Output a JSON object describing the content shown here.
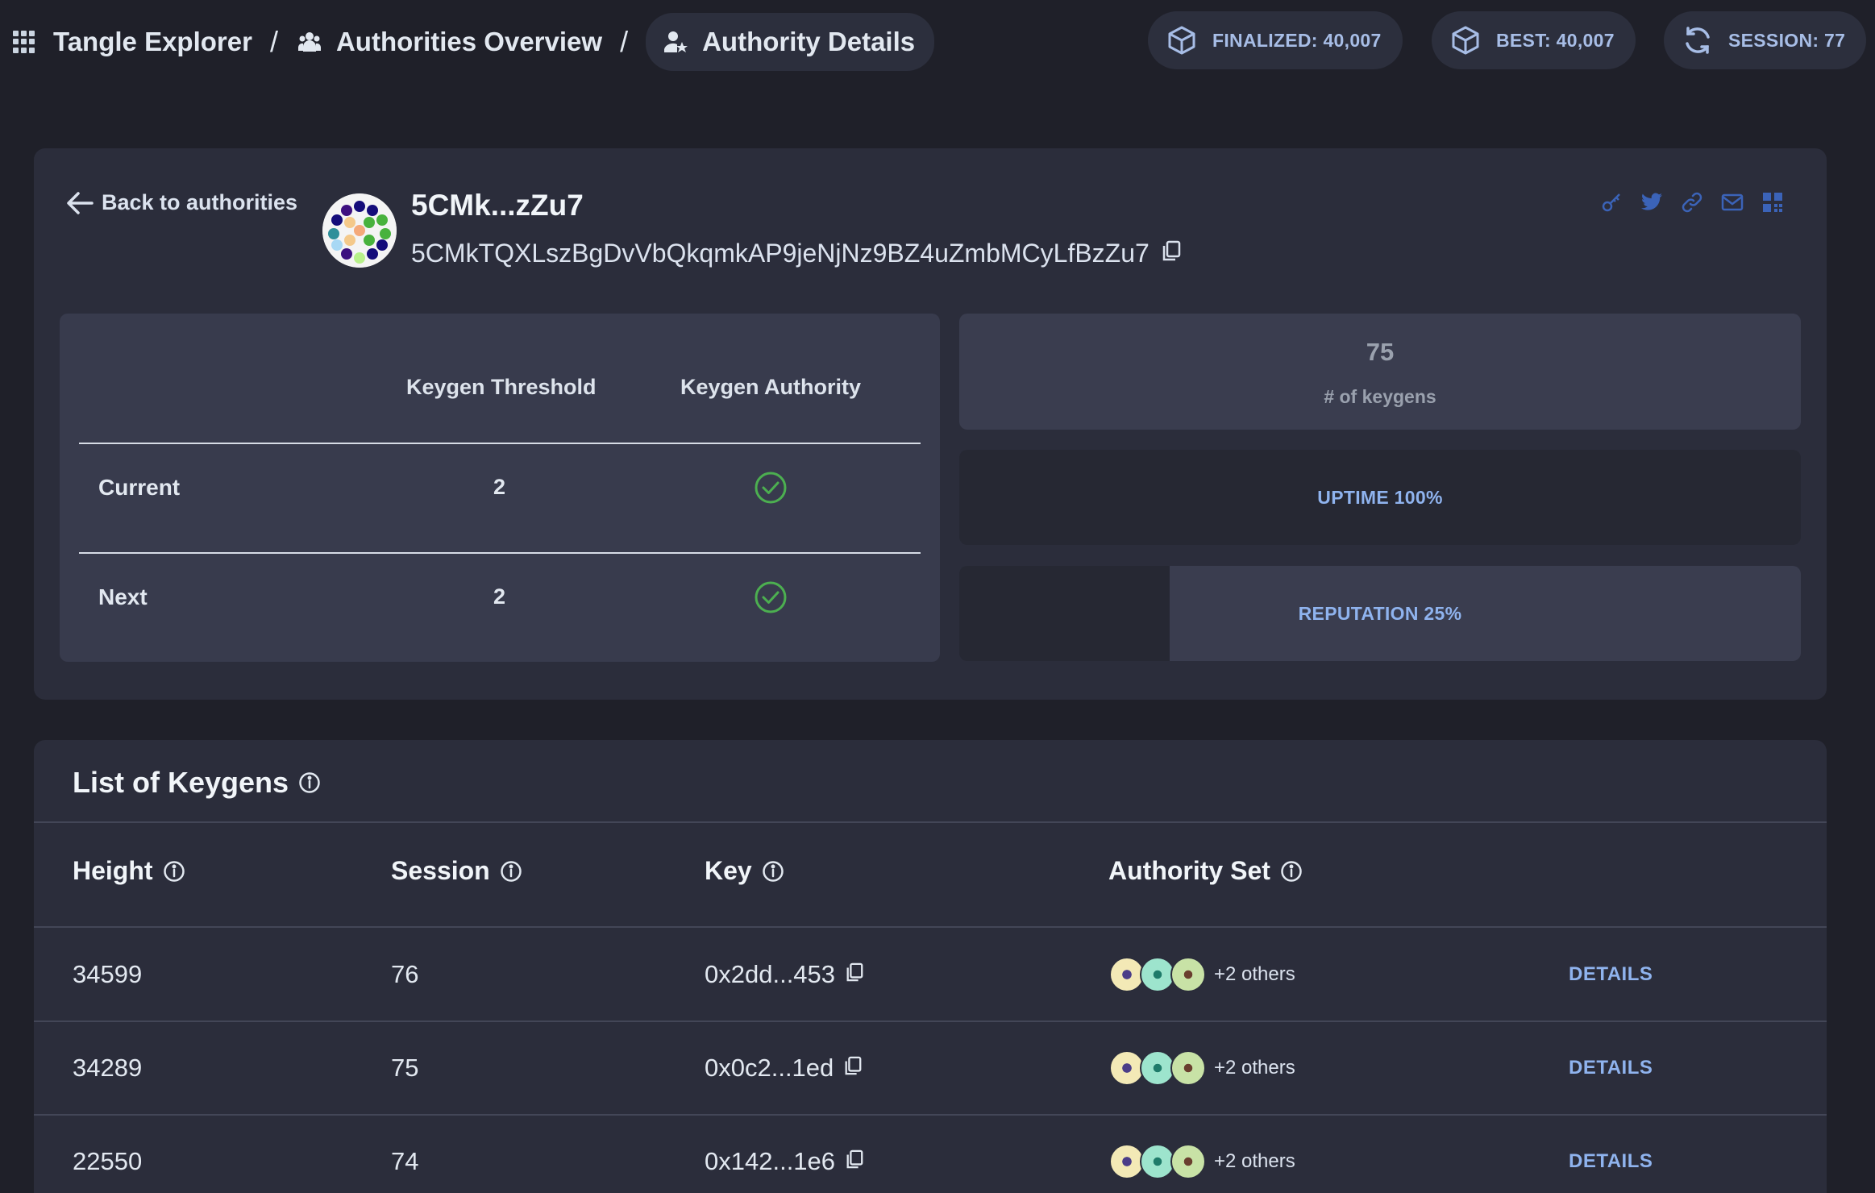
{
  "breadcrumb": {
    "app_title": "Tangle Explorer",
    "separator": "/",
    "overview": "Authorities Overview",
    "current": "Authority Details"
  },
  "status": {
    "finalized": "FINALIZED: 40,007",
    "best": "BEST: 40,007",
    "session": "SESSION: 77"
  },
  "authority": {
    "back_label": "Back to authorities",
    "short_address": "5CMk...zZu7",
    "full_address": "5CMkTQXLszBgDvVbQkqmkAP9jeNjNz9BZ4uZmbMCyLfBzZu7",
    "social_icons": [
      "key-icon",
      "twitter-icon",
      "link-icon",
      "mail-icon",
      "grid-icon"
    ]
  },
  "keygen_table": {
    "headers": [
      "Keygen Threshold",
      "Keygen Authority"
    ],
    "rows": [
      {
        "label": "Current",
        "threshold": "2",
        "authority": true
      },
      {
        "label": "Next",
        "threshold": "2",
        "authority": true
      }
    ]
  },
  "stats": {
    "keygens_count": "75",
    "keygens_label": "# of keygens",
    "uptime_label": "UPTIME 100%",
    "uptime_value": 100,
    "reputation_label": "REPUTATION 25%",
    "reputation_value": 25
  },
  "keygens_list": {
    "title": "List of Keygens",
    "columns": [
      "Height",
      "Session",
      "Key",
      "Authority Set"
    ],
    "rows": [
      {
        "height": "34599",
        "session": "76",
        "key": "0x2dd...453",
        "others": "+2 others",
        "action": "DETAILS"
      },
      {
        "height": "34289",
        "session": "75",
        "key": "0x0c2...1ed",
        "others": "+2 others",
        "action": "DETAILS"
      },
      {
        "height": "22550",
        "session": "74",
        "key": "0x142...1e6",
        "others": "+2 others",
        "action": "DETAILS"
      }
    ]
  },
  "colors": {
    "background": "#1f2029",
    "card": "#2b2d3b",
    "accent": "#8fb3ee",
    "check": "#4caf50"
  }
}
